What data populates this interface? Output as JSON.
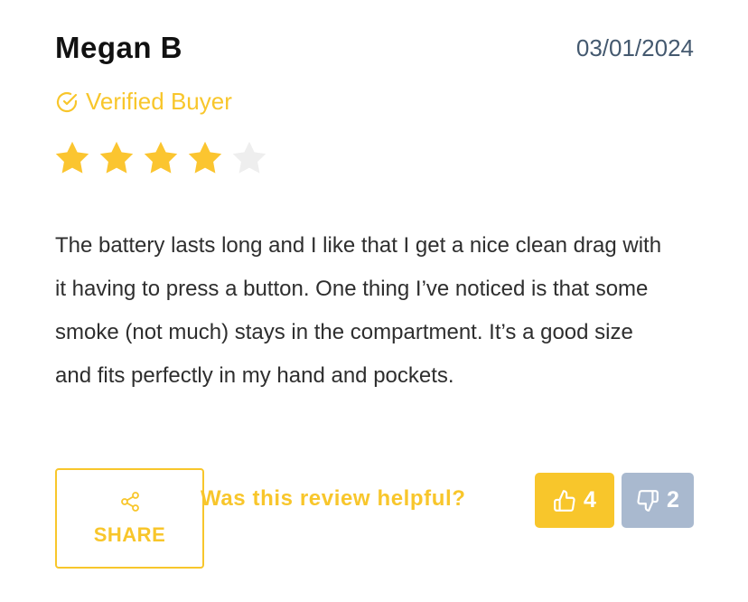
{
  "review": {
    "author": "Megan B",
    "date": "03/01/2024",
    "verified_label": "Verified Buyer",
    "rating": 4,
    "rating_max": 5,
    "body": "The battery lasts long and I like that I get a nice clean drag with it having to press a button. One thing I’ve noticed is that some smoke (not much) stays in the compartment. It’s a good size and fits perfectly in my hand and pockets."
  },
  "actions": {
    "share_label": "SHARE",
    "helpful_question": "Was this review helpful?",
    "upvotes": "4",
    "downvotes": "2"
  },
  "icons": {
    "verified": "check-circle-icon",
    "star": "star-icon",
    "share": "share-icon",
    "upvote": "thumbs-up-icon",
    "downvote": "thumbs-down-icon"
  },
  "colors": {
    "accent": "#f8c62b",
    "star_filled": "#fbc530",
    "star_empty": "#eeeeee",
    "date": "#44596f",
    "downvote_bg": "#a9b9cf"
  }
}
